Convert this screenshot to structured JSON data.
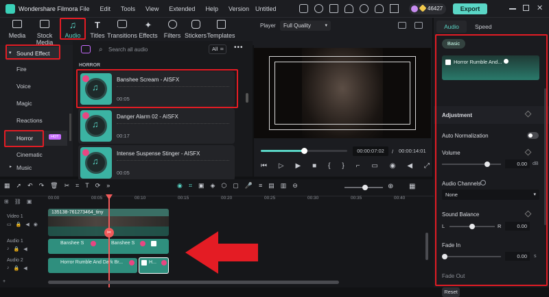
{
  "app": {
    "name": "Wondershare Filmora",
    "project": "Untitled",
    "points": "46427",
    "export_label": "Export"
  },
  "menu": [
    "File",
    "Edit",
    "Tools",
    "View",
    "Extended",
    "Help",
    "Version"
  ],
  "toolbar": [
    "Media",
    "Stock Media",
    "Audio",
    "Titles",
    "Transitions",
    "Effects",
    "Filters",
    "Stickers",
    "Templates"
  ],
  "leftnav": {
    "header": "Sound Effect",
    "items": [
      "Fire",
      "Voice",
      "Magic",
      "Reactions",
      "Horror",
      "Cinematic",
      "Music"
    ],
    "hot_badge": "HOT"
  },
  "library": {
    "search_placeholder": "Search all audio",
    "filter": "All",
    "category": "HORROR",
    "items": [
      {
        "name": "Banshee Scream - AISFX",
        "duration": "00:05"
      },
      {
        "name": "Danger Alarm 02 - AISFX",
        "duration": "00:17"
      },
      {
        "name": "Intense Suspense Stinger - AISFX",
        "duration": "00:05"
      }
    ]
  },
  "player": {
    "label": "Player",
    "quality": "Full Quality",
    "current": "00:00:07:02",
    "total": "00:00:14:01",
    "progress": 0.5
  },
  "right_panel": {
    "tabs": [
      "Audio",
      "Speed"
    ],
    "basic_label": "Basic",
    "clip_name": "Horror Rumble And...",
    "adjustment": "Adjustment",
    "auto_norm": "Auto Normalization",
    "volume_label": "Volume",
    "volume_value": "0.00",
    "volume_unit": "dB",
    "channels_label": "Audio Channels",
    "channels_value": "None",
    "balance_label": "Sound Balance",
    "balance_left": "L",
    "balance_right": "R",
    "balance_value": "0.00",
    "fadein_label": "Fade In",
    "fadein_value": "0.00",
    "fadein_unit": "s",
    "fadeout_label": "Fade Out",
    "reset_label": "Reset"
  },
  "timeline": {
    "ruler": [
      "00:00",
      "00:05",
      "00:10",
      "00:15",
      "00:20",
      "00:25",
      "00:30",
      "00:35",
      "00:40"
    ],
    "tracks": [
      "Video 1",
      "Audio 1",
      "Audio 2"
    ],
    "video_clip": "135138-761273464_tiny",
    "audio1_clips": [
      "Banshee S",
      "Banshee S"
    ],
    "audio2_clips": [
      "Horror Rumble And Dark Br...",
      "H..."
    ],
    "count_1": "1",
    "count_2": "2"
  },
  "colors": {
    "accent": "#5ad6c6",
    "highlight": "#e41c24",
    "playhead": "#f05a5a",
    "audio_clip": "#2f8f7e"
  }
}
